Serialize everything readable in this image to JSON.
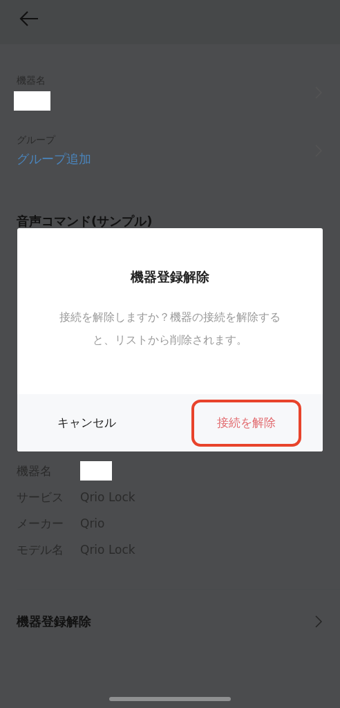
{
  "fields": [
    {
      "label": "機器名",
      "kind": "redacted"
    },
    {
      "label": "グループ",
      "kind": "link",
      "value": "グループ追加"
    }
  ],
  "section_title": "音声コマンド(サンプル)",
  "dialog": {
    "title": "機器登録解除",
    "message": "接続を解除しますか？機器の接続を解除すると、リストから削除されます。",
    "cancel": "キャンセル",
    "confirm": "接続を解除",
    "confirm_highlighted": true
  },
  "info": [
    {
      "label": "機器名",
      "kind": "redacted"
    },
    {
      "label": "サービス",
      "kind": "text",
      "value": "Qrio Lock"
    },
    {
      "label": "メーカー",
      "kind": "text",
      "value": "Qrio"
    },
    {
      "label": "モデル名",
      "kind": "text",
      "value": "Qrio Lock"
    }
  ],
  "unregister": "機器登録解除"
}
